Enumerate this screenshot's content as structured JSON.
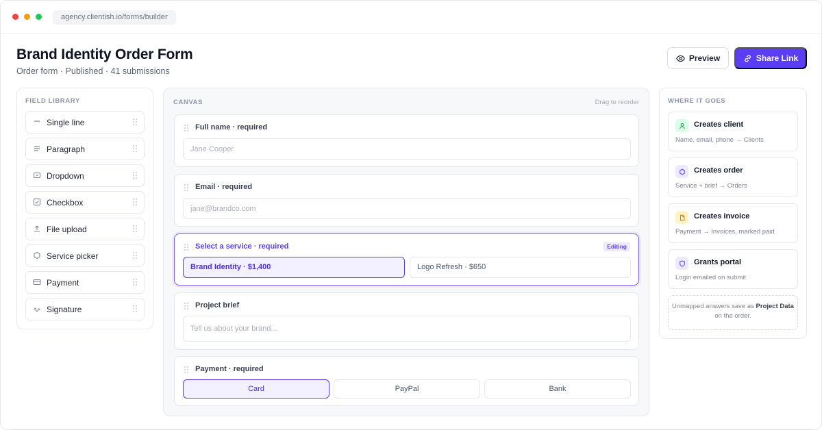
{
  "browser": {
    "url": "agency.clientish.io/forms/builder"
  },
  "header": {
    "title": "Brand Identity Order Form",
    "subtitle": "Order form · Published · 41 submissions",
    "preview_label": "Preview",
    "share_label": "Share Link",
    "accent_color": "#5b3df5"
  },
  "library": {
    "heading": "FIELD LIBRARY",
    "items": [
      {
        "label": "Single line",
        "icon": "minus-icon"
      },
      {
        "label": "Paragraph",
        "icon": "lines-icon"
      },
      {
        "label": "Dropdown",
        "icon": "dropdown-icon"
      },
      {
        "label": "Checkbox",
        "icon": "checkbox-icon"
      },
      {
        "label": "File upload",
        "icon": "upload-icon"
      },
      {
        "label": "Service picker",
        "icon": "hexagon-icon"
      },
      {
        "label": "Payment",
        "icon": "credit-card-icon"
      },
      {
        "label": "Signature",
        "icon": "signature-icon"
      }
    ]
  },
  "canvas": {
    "heading": "CANVAS",
    "hint": "Drag to reorder",
    "fields": {
      "full_name": {
        "label": "Full name · required",
        "placeholder": "Jane Cooper"
      },
      "email": {
        "label": "Email · required",
        "placeholder": "jane@brandco.com"
      },
      "service": {
        "label": "Select a service · required",
        "badge": "Editing",
        "options": [
          "Brand Identity · $1,400",
          "Logo Refresh · $650"
        ],
        "selected": "Brand Identity · $1,400"
      },
      "brief": {
        "label": "Project brief",
        "placeholder": "Tell us about your brand..."
      },
      "payment": {
        "label": "Payment · required",
        "options": [
          "Card",
          "PayPal",
          "Bank"
        ],
        "selected": "Card"
      }
    }
  },
  "destinations": {
    "heading": "WHERE IT GOES",
    "items": [
      {
        "title": "Creates client",
        "desc": "Name, email, phone → Clients",
        "icon": "user-icon",
        "color": "#16a34a",
        "bg": "#dcfce7"
      },
      {
        "title": "Creates order",
        "desc": "Service + brief → Orders",
        "icon": "hexagon-icon",
        "color": "#5b3df5",
        "bg": "#ede9fe"
      },
      {
        "title": "Creates invoice",
        "desc": "Payment → Invoices, marked paid",
        "icon": "document-icon",
        "color": "#d97706",
        "bg": "#fef3c7"
      },
      {
        "title": "Grants portal",
        "desc": "Login emailed on submit",
        "icon": "shield-icon",
        "color": "#5b3df5",
        "bg": "#ede9fe"
      }
    ],
    "unmapped": {
      "prefix": "Unmapped answers save as ",
      "bold": "Project Data",
      "suffix": " on the order."
    }
  }
}
